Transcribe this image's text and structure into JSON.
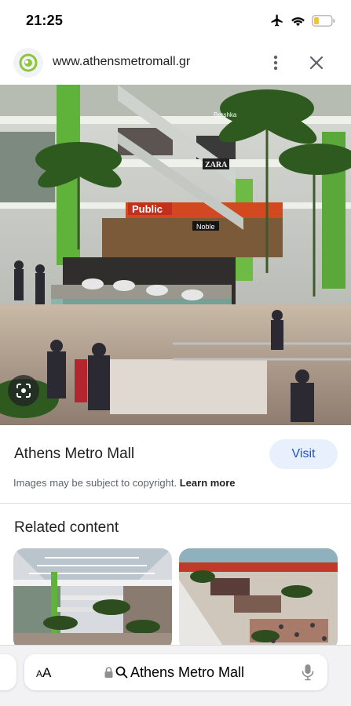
{
  "status_bar": {
    "time": "21:25",
    "icons": [
      "airplane-mode-icon",
      "wifi-icon",
      "battery-low-icon"
    ],
    "battery_color": "#f4c430"
  },
  "browser": {
    "url": "www.athensmetromall.gr",
    "site_icon": "athens-metro-mall-logo-icon"
  },
  "result": {
    "title": "Athens Metro Mall",
    "visit_label": "Visit",
    "copyright_text": "Images may be subject to copyright.",
    "learn_more_label": "Learn more"
  },
  "related": {
    "heading": "Related content"
  },
  "hero_signs": [
    "Public",
    "ZARA",
    "Noble",
    "Bershka"
  ],
  "bottom_bar": {
    "text_size_label_small": "A",
    "text_size_label_large": "A",
    "address": "Athens Metro Mall"
  },
  "colors": {
    "accent": "#1a56c4",
    "visit_bg": "#e8f0fe",
    "logo_green": "#8cc63f"
  }
}
